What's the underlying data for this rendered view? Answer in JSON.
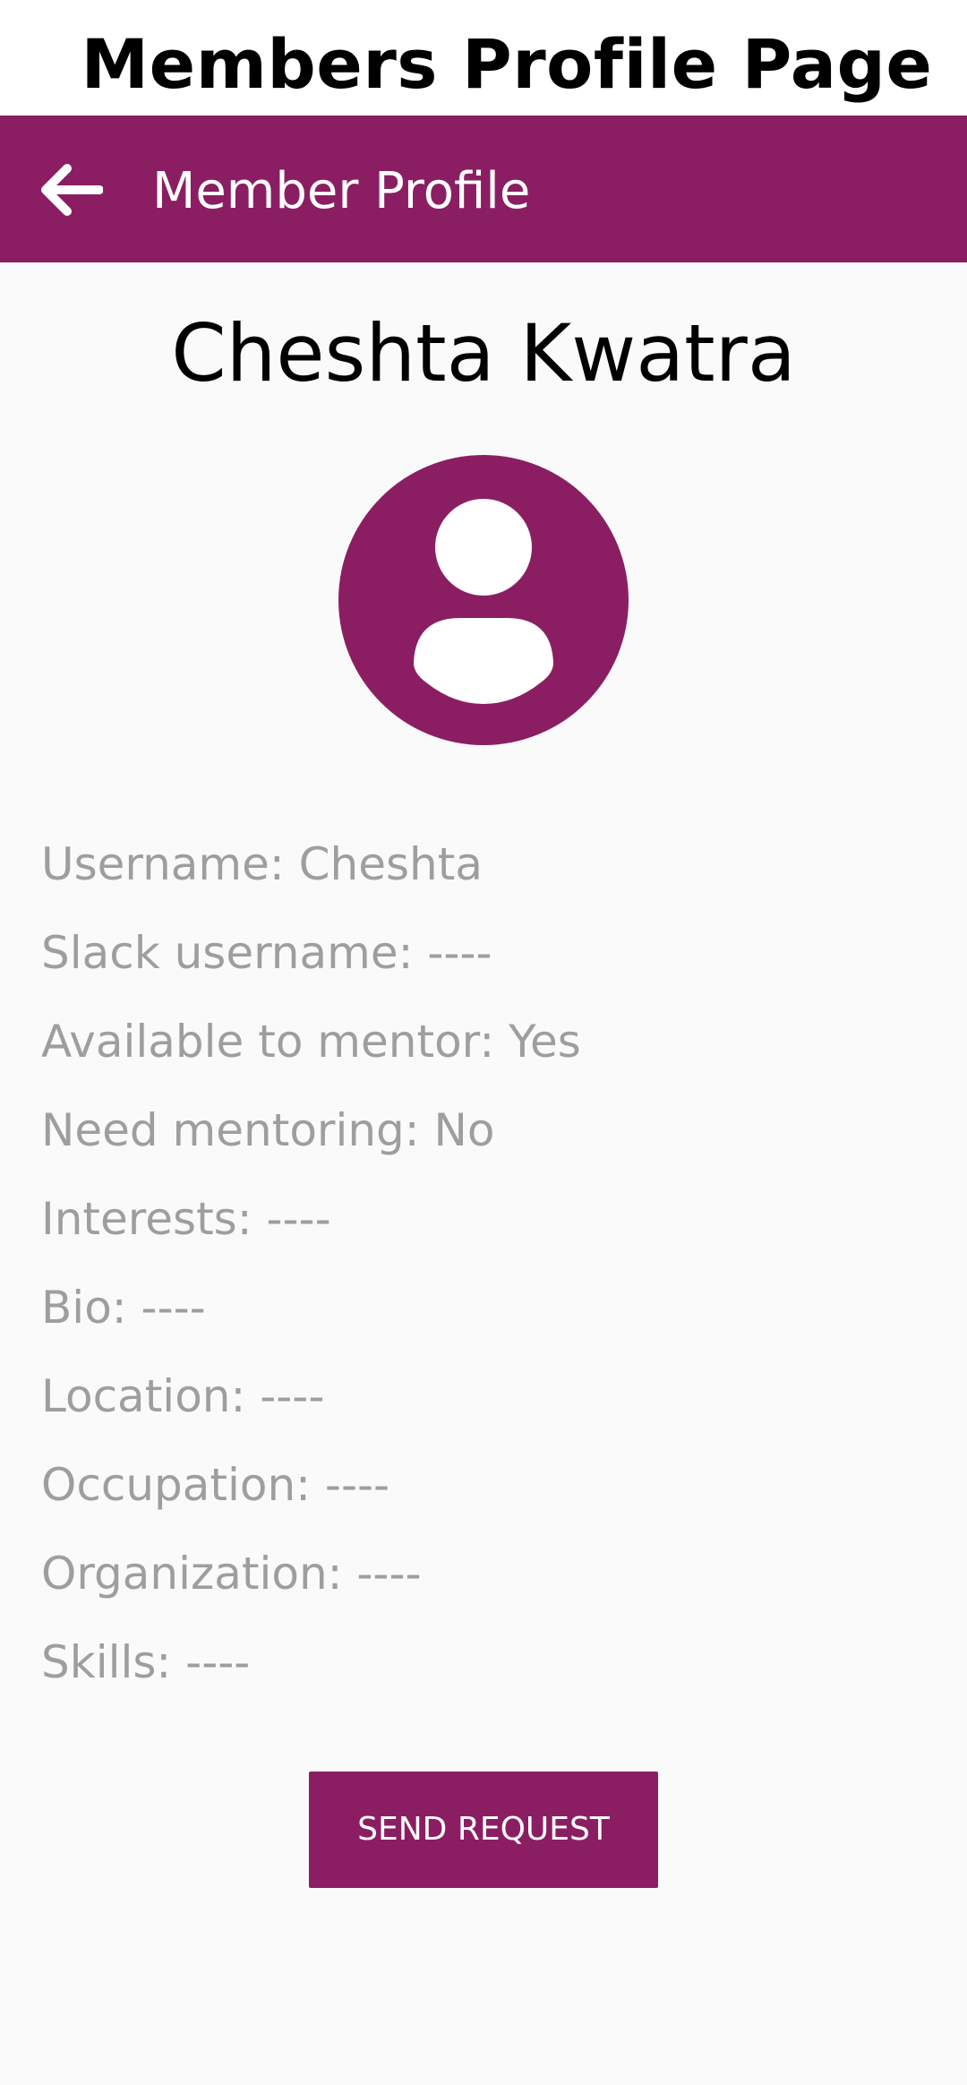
{
  "page_heading": "Members Profile Page",
  "app_bar": {
    "title": "Member Profile",
    "back_icon": "arrow-back-icon",
    "color": "#8b1e63"
  },
  "profile": {
    "name": "Cheshta Kwatra",
    "avatar_icon": "account-circle-icon",
    "details": [
      "Username: Cheshta",
      "Slack username: ----",
      "Available to mentor: Yes",
      "Need mentoring: No",
      "Interests: ----",
      "Bio: ----",
      "Location: ----",
      "Occupation: ----",
      "Organization: ----",
      "Skills: ----"
    ]
  },
  "actions": {
    "send_request_label": "SEND REQUEST"
  },
  "colors": {
    "primary": "#8b1e63",
    "background": "#fafafa",
    "detail_text": "#9e9e9e"
  }
}
